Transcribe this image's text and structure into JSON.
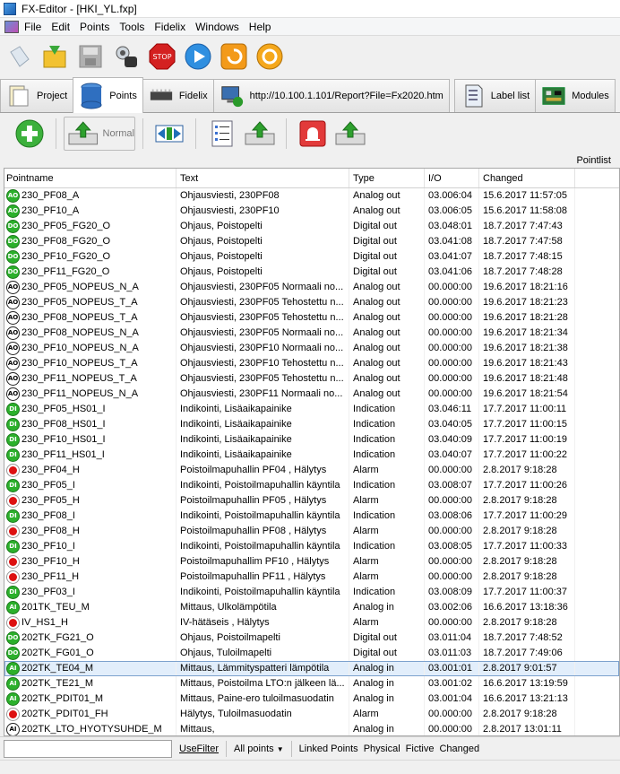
{
  "window": {
    "title": "FX-Editor - [HKI_YL.fxp]"
  },
  "menu": [
    "File",
    "Edit",
    "Points",
    "Tools",
    "Fidelix",
    "Windows",
    "Help"
  ],
  "tabs": [
    {
      "label": "Project",
      "icon": "project-icon"
    },
    {
      "label": "Points",
      "icon": "database-icon",
      "active": true
    },
    {
      "label": "Fidelix",
      "icon": "chip-icon"
    },
    {
      "label": "http://10.100.1.101/Report?File=Fx2020.htm",
      "icon": "network-computer-icon"
    },
    {
      "label": "Label list",
      "icon": "label-icon"
    },
    {
      "label": "Modules",
      "icon": "module-icon"
    }
  ],
  "toolbar2": {
    "normal_label": "Normal"
  },
  "pointlist_label": "Pointlist",
  "columns": [
    "Pointname",
    "Text",
    "Type",
    "I/O",
    "Changed"
  ],
  "rows": [
    {
      "icon": "AO",
      "name": "230_PF08_A",
      "text": "Ohjausviesti, 230PF08",
      "type": "Analog out",
      "io": "03.006:04",
      "changed": "15.6.2017 11:57:05"
    },
    {
      "icon": "AO",
      "name": "230_PF10_A",
      "text": "Ohjausviesti, 230PF10",
      "type": "Analog out",
      "io": "03.006:05",
      "changed": "15.6.2017 11:58:08"
    },
    {
      "icon": "DO",
      "name": "230_PF05_FG20_O",
      "text": "Ohjaus, Poistopelti",
      "type": "Digital out",
      "io": "03.048:01",
      "changed": "18.7.2017 7:47:43"
    },
    {
      "icon": "DO",
      "name": "230_PF08_FG20_O",
      "text": "Ohjaus, Poistopelti",
      "type": "Digital out",
      "io": "03.041:08",
      "changed": "18.7.2017 7:47:58"
    },
    {
      "icon": "DO",
      "name": "230_PF10_FG20_O",
      "text": "Ohjaus, Poistopelti",
      "type": "Digital out",
      "io": "03.041:07",
      "changed": "18.7.2017 7:48:15"
    },
    {
      "icon": "DO",
      "name": "230_PF11_FG20_O",
      "text": "Ohjaus, Poistopelti",
      "type": "Digital out",
      "io": "03.041:06",
      "changed": "18.7.2017 7:48:28"
    },
    {
      "icon": "AOW",
      "name": "230_PF05_NOPEUS_N_A",
      "text": "Ohjausviesti, 230PF05 Normaali no...",
      "type": "Analog out",
      "io": "00.000:00",
      "changed": "19.6.2017 18:21:16"
    },
    {
      "icon": "AOW",
      "name": "230_PF05_NOPEUS_T_A",
      "text": "Ohjausviesti, 230PF05 Tehostettu n...",
      "type": "Analog out",
      "io": "00.000:00",
      "changed": "19.6.2017 18:21:23"
    },
    {
      "icon": "AOW",
      "name": "230_PF08_NOPEUS_T_A",
      "text": "Ohjausviesti, 230PF05 Tehostettu n...",
      "type": "Analog out",
      "io": "00.000:00",
      "changed": "19.6.2017 18:21:28"
    },
    {
      "icon": "AOW",
      "name": "230_PF08_NOPEUS_N_A",
      "text": "Ohjausviesti, 230PF05 Normaali no...",
      "type": "Analog out",
      "io": "00.000:00",
      "changed": "19.6.2017 18:21:34"
    },
    {
      "icon": "AOW",
      "name": "230_PF10_NOPEUS_N_A",
      "text": "Ohjausviesti, 230PF10 Normaali no...",
      "type": "Analog out",
      "io": "00.000:00",
      "changed": "19.6.2017 18:21:38"
    },
    {
      "icon": "AOW",
      "name": "230_PF10_NOPEUS_T_A",
      "text": "Ohjausviesti, 230PF10 Tehostettu n...",
      "type": "Analog out",
      "io": "00.000:00",
      "changed": "19.6.2017 18:21:43"
    },
    {
      "icon": "AOW",
      "name": "230_PF11_NOPEUS_T_A",
      "text": "Ohjausviesti, 230PF05 Tehostettu n...",
      "type": "Analog out",
      "io": "00.000:00",
      "changed": "19.6.2017 18:21:48"
    },
    {
      "icon": "AOW",
      "name": "230_PF11_NOPEUS_N_A",
      "text": "Ohjausviesti, 230PF11 Normaali no...",
      "type": "Analog out",
      "io": "00.000:00",
      "changed": "19.6.2017 18:21:54"
    },
    {
      "icon": "DI",
      "name": "230_PF05_HS01_I",
      "text": "Indikointi, Lisäaikapainike",
      "type": "Indication",
      "io": "03.046:11",
      "changed": "17.7.2017 11:00:11"
    },
    {
      "icon": "DI",
      "name": "230_PF08_HS01_I",
      "text": "Indikointi, Lisäaikapainike",
      "type": "Indication",
      "io": "03.040:05",
      "changed": "17.7.2017 11:00:15"
    },
    {
      "icon": "DI",
      "name": "230_PF10_HS01_I",
      "text": "Indikointi, Lisäaikapainike",
      "type": "Indication",
      "io": "03.040:09",
      "changed": "17.7.2017 11:00:19"
    },
    {
      "icon": "DI",
      "name": "230_PF11_HS01_I",
      "text": "Indikointi, Lisäaikapainike",
      "type": "Indication",
      "io": "03.040:07",
      "changed": "17.7.2017 11:00:22"
    },
    {
      "icon": "AL",
      "name": "230_PF04_H",
      "text": "Poistoilmapuhallin PF04 , Hälytys",
      "type": "Alarm",
      "io": "00.000:00",
      "changed": "2.8.2017 9:18:28"
    },
    {
      "icon": "DI",
      "name": "230_PF05_I",
      "text": "Indikointi, Poistoilmapuhallin käyntila",
      "type": "Indication",
      "io": "03.008:07",
      "changed": "17.7.2017 11:00:26"
    },
    {
      "icon": "AL",
      "name": "230_PF05_H",
      "text": "Poistoilmapuhallin PF05 , Hälytys",
      "type": "Alarm",
      "io": "00.000:00",
      "changed": "2.8.2017 9:18:28"
    },
    {
      "icon": "DI",
      "name": "230_PF08_I",
      "text": "Indikointi, Poistoilmapuhallin käyntila",
      "type": "Indication",
      "io": "03.008:06",
      "changed": "17.7.2017 11:00:29"
    },
    {
      "icon": "AL",
      "name": "230_PF08_H",
      "text": "Poistoilmapuhallin PF08 , Hälytys",
      "type": "Alarm",
      "io": "00.000:00",
      "changed": "2.8.2017 9:18:28"
    },
    {
      "icon": "DI",
      "name": "230_PF10_I",
      "text": "Indikointi, Poistoilmapuhallin käyntila",
      "type": "Indication",
      "io": "03.008:05",
      "changed": "17.7.2017 11:00:33"
    },
    {
      "icon": "AL",
      "name": "230_PF10_H",
      "text": "Poistoilmapuhallim PF10 , Hälytys",
      "type": "Alarm",
      "io": "00.000:00",
      "changed": "2.8.2017 9:18:28"
    },
    {
      "icon": "AL",
      "name": "230_PF11_H",
      "text": "Poistoilmapuhallin PF11 , Hälytys",
      "type": "Alarm",
      "io": "00.000:00",
      "changed": "2.8.2017 9:18:28"
    },
    {
      "icon": "DI",
      "name": "230_PF03_I",
      "text": "Indikointi, Poistoilmapuhallin käyntila",
      "type": "Indication",
      "io": "03.008:09",
      "changed": "17.7.2017 11:00:37"
    },
    {
      "icon": "AI",
      "name": "201TK_TEU_M",
      "text": "Mittaus, Ulkolämpötila",
      "type": "Analog in",
      "io": "03.002:06",
      "changed": "16.6.2017 13:18:36"
    },
    {
      "icon": "AL",
      "name": "IV_HS1_H",
      "text": "IV-hätäseis , Hälytys",
      "type": "Alarm",
      "io": "00.000:00",
      "changed": "2.8.2017 9:18:28"
    },
    {
      "icon": "DO",
      "name": "202TK_FG21_O",
      "text": "Ohjaus, Poistoilmapelti",
      "type": "Digital out",
      "io": "03.011:04",
      "changed": "18.7.2017 7:48:52"
    },
    {
      "icon": "DO",
      "name": "202TK_FG01_O",
      "text": "Ohjaus, Tuloilmapelti",
      "type": "Digital out",
      "io": "03.011:03",
      "changed": "18.7.2017 7:49:06"
    },
    {
      "icon": "AI",
      "name": "202TK_TE04_M",
      "text": "Mittaus, Lämmityspatteri lämpötila",
      "type": "Analog in",
      "io": "03.001:01",
      "changed": "2.8.2017 9:01:57",
      "selected": true
    },
    {
      "icon": "AI",
      "name": "202TK_TE21_M",
      "text": "Mittaus, Poistoilma LTO:n jälkeen lä...",
      "type": "Analog in",
      "io": "03.001:02",
      "changed": "16.6.2017 13:19:59"
    },
    {
      "icon": "AI",
      "name": "202TK_PDIT01_M",
      "text": "Mittaus, Paine-ero tuloilmasuodatin",
      "type": "Analog in",
      "io": "03.001:04",
      "changed": "16.6.2017 13:21:13"
    },
    {
      "icon": "AL",
      "name": "202TK_PDIT01_FH",
      "text": "Hälytys, Tuloilmasuodatin",
      "type": "Alarm",
      "io": "00.000:00",
      "changed": "2.8.2017 9:18:28"
    },
    {
      "icon": "AIW",
      "name": "202TK_LTO_HYOTYSUHDE_M",
      "text": "Mittaus,",
      "type": "Analog in",
      "io": "00.000:00",
      "changed": "2.8.2017 13:01:11"
    }
  ],
  "bottom": {
    "usefilter": "UseFilter",
    "filter_value": "All points",
    "linked": "Linked Points",
    "physical": "Physical",
    "fictive": "Fictive",
    "changed": "Changed"
  },
  "icon_labels": {
    "AO": "AO",
    "AOW": "AO",
    "DO": "DO",
    "DI": "DI",
    "AI": "AI",
    "AIW": "AI",
    "AL": ""
  }
}
